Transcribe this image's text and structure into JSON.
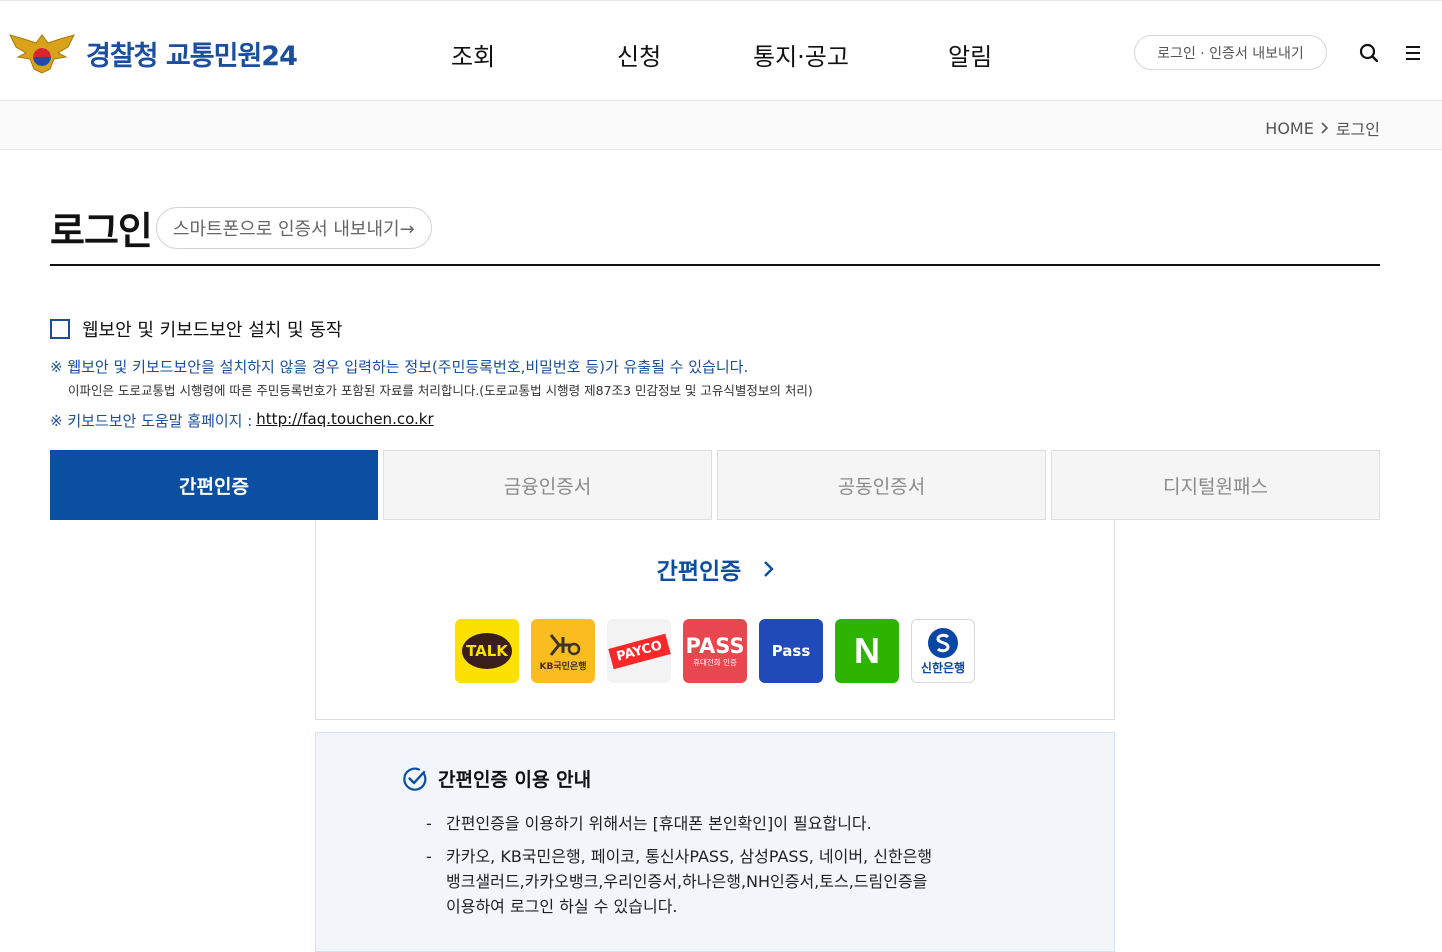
{
  "header": {
    "logo_text": "경찰청 교통민원24",
    "nav": [
      "조회",
      "신청",
      "통지·공고",
      "알림"
    ],
    "cert_export_label": "로그인 · 인증서 내보내기",
    "icons": [
      "search-icon",
      "menu-icon"
    ]
  },
  "breadcrumb": {
    "home": "HOME",
    "current": "로그인"
  },
  "page": {
    "title": "로그인",
    "phone_export_label": "스마트폰으로 인증서 내보내기→"
  },
  "security": {
    "checkbox_label": "웹보안 및 키보드보안 설치 및 동작",
    "checked": false,
    "notice_line1": "※ 웹보안 및 키보드보안을 설치하지 않을 경우 입력하는 정보(주민등록번호,비밀번호 등)가 유출될 수 있습니다.",
    "notice_line1_sub": "이파인은 도로교통법 시행령에 따른 주민등록번호가 포함된 자료를 처리합니다.(도로교통법 시행령 제87조3 민감정보 및 고유식별정보의 처리)",
    "notice_line2_label": "※ 키보드보안 도움말 홈페이지 :",
    "notice_line2_link": "http://faq.touchen.co.kr"
  },
  "tabs": [
    {
      "label": "간편인증",
      "active": true
    },
    {
      "label": "금융인증서",
      "active": false
    },
    {
      "label": "공동인증서",
      "active": false
    },
    {
      "label": "디지털원패스",
      "active": false
    }
  ],
  "simple_auth": {
    "heading": "간편인증",
    "providers": [
      {
        "name": "kakao",
        "label": "TALK"
      },
      {
        "name": "kb",
        "label": "KB국민은행"
      },
      {
        "name": "payco",
        "label": "PAYCO"
      },
      {
        "name": "pass-telecom",
        "label": "PASS",
        "sub": "휴대전화 인증"
      },
      {
        "name": "samsung-pass",
        "label": "Pass"
      },
      {
        "name": "naver",
        "label": "N"
      },
      {
        "name": "shinhan",
        "label": "신한은행"
      }
    ]
  },
  "guide": {
    "title": "간편인증 이용 안내",
    "items": [
      "간편인증을 이용하기 위해서는 [휴대폰 본인확인]이 필요합니다.",
      "카카오, KB국민은행, 페이코, 통신사PASS, 삼성PASS, 네이버, 신한은행"
    ],
    "item2_line2": "뱅크샐러드,카카오뱅크,우리인증서,하나은행,NH인증서,토스,드림인증을",
    "item2_line3": "이용하여 로그인 하실 수 있습니다."
  },
  "colors": {
    "primary": "#0b4fa2",
    "brand_text": "#1b4f9c"
  }
}
